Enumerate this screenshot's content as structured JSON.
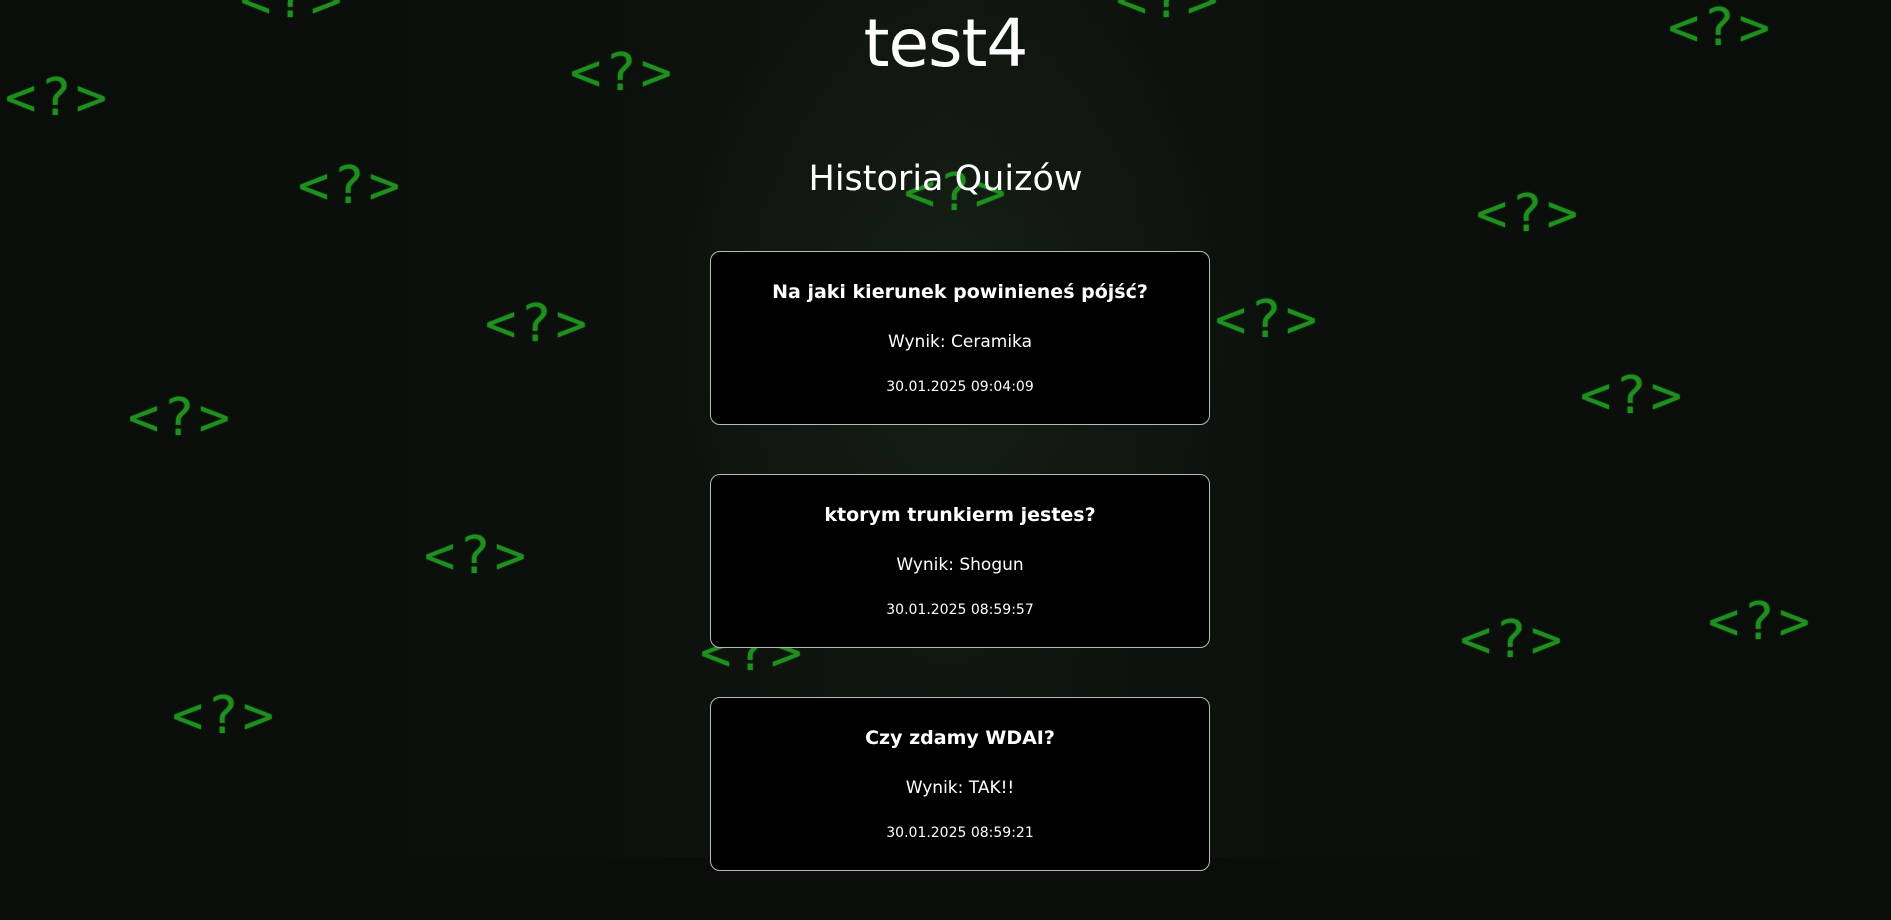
{
  "background": {
    "glyph": "<?>",
    "glyph_color": "#1f8f1f",
    "base_color": "#0a0d0a"
  },
  "page": {
    "title": "test4"
  },
  "history": {
    "heading": "Historia Quizów",
    "entries": [
      {
        "title": "Na jaki kierunek powinieneś pójść?",
        "result": "Wynik: Ceramika",
        "date": "30.01.2025 09:04:09"
      },
      {
        "title": "ktorym trunkierm jestes?",
        "result": "Wynik: Shogun",
        "date": "30.01.2025 08:59:57"
      },
      {
        "title": "Czy zdamy WDAI?",
        "result": "Wynik: TAK!!",
        "date": "30.01.2025 08:59:21"
      }
    ]
  }
}
